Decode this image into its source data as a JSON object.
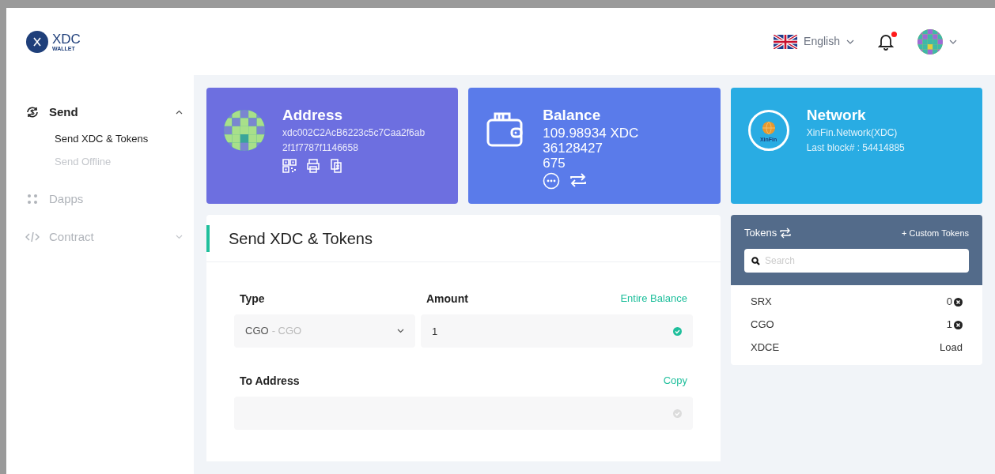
{
  "header": {
    "logo": {
      "title": "XDC",
      "subtitle": "WALLET"
    },
    "language": "English",
    "notifications": {
      "unread": true
    }
  },
  "sidebar": {
    "items": [
      {
        "label": "Send",
        "selected": true,
        "kind": "group",
        "expanded": true,
        "children": [
          {
            "label": "Send XDC & Tokens",
            "selected": true
          },
          {
            "label": "Send Offline",
            "selected": false
          }
        ]
      },
      {
        "label": "Dapps",
        "selected": false,
        "kind": "link"
      },
      {
        "label": "Contract",
        "selected": false,
        "kind": "group",
        "expanded": false
      }
    ]
  },
  "cards": [
    {
      "kind": "address",
      "title": "Address",
      "lines": [
        "xdc002C2AcB6223c5c7Caa2f6ab",
        "2f1f7787f1146658"
      ]
    },
    {
      "kind": "balance",
      "title": "Balance",
      "lines": [
        "109.98934 XDC",
        "36128427",
        "675"
      ]
    },
    {
      "kind": "network",
      "title": "Network",
      "lines": [
        "XinFin.Network(XDC)",
        "Last block# : 54414885"
      ],
      "logo_text": "XinFin"
    }
  ],
  "send_form": {
    "title": "Send XDC & Tokens",
    "type": {
      "label": "Type",
      "value": "CGO",
      "sub": "- CGO"
    },
    "amount": {
      "label": "Amount",
      "action": "Entire Balance",
      "value": "1",
      "valid": true
    },
    "to_address": {
      "label": "To Address",
      "action": "Copy",
      "valid": false
    }
  },
  "tokens": {
    "title": "Tokens",
    "action": "+ Custom Tokens",
    "search_placeholder": "Search",
    "rows": [
      {
        "symbol": "SRX",
        "kind": "balance",
        "value": "0"
      },
      {
        "symbol": "CGO",
        "kind": "balance",
        "value": "1"
      },
      {
        "symbol": "XDCE",
        "kind": "load",
        "value": "Load"
      }
    ]
  }
}
